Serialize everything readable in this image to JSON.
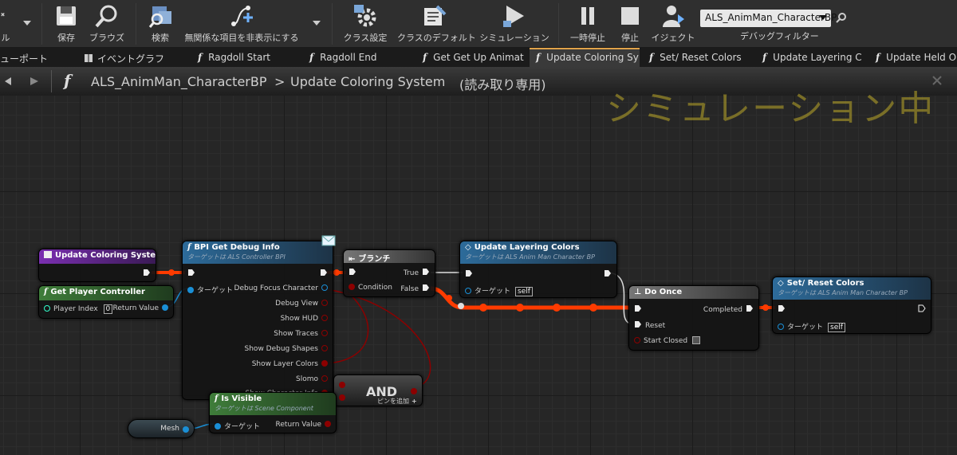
{
  "toolbar": {
    "partial_label": "ル",
    "buttons": [
      {
        "label": "保存"
      },
      {
        "label": "ブラウズ"
      },
      {
        "label": "検索"
      },
      {
        "label": "無関係な項目を非表示にする"
      },
      {
        "label": "クラス設定"
      },
      {
        "label": "クラスのデフォルト"
      },
      {
        "label": "シミュレーション"
      },
      {
        "label": "一時停止"
      },
      {
        "label": "停止"
      },
      {
        "label": "イジェクト"
      }
    ],
    "debug_object": "ALS_AnimMan_CharacterBP",
    "debug_filter_label": "デバッグフィルター"
  },
  "tabs": [
    {
      "label": "ューポート"
    },
    {
      "label": "イベントグラフ"
    },
    {
      "label": "Ragdoll Start"
    },
    {
      "label": "Ragdoll End"
    },
    {
      "label": "Get Get Up Animat"
    },
    {
      "label": "Update Coloring Sy"
    },
    {
      "label": "Set/ Reset Colors"
    },
    {
      "label": "Update Layering C"
    },
    {
      "label": "Update Held Obje"
    }
  ],
  "breadcrumb": {
    "blueprint": "ALS_AnimMan_CharacterBP",
    "separator": ">",
    "function": "Update Coloring System",
    "readonly": "(読み取り専用)"
  },
  "watermark": "シミュレーション中",
  "nodes": {
    "entry": {
      "title": "Update Coloring System"
    },
    "get_pc": {
      "title": "Get Player Controller",
      "player_index_label": "Player Index",
      "player_index_value": "0",
      "return_label": "Return Value"
    },
    "bpi": {
      "title": "BPI Get Debug Info",
      "subtitle": "ターゲットは ALS Controller BPI",
      "target_label": "ターゲット",
      "outputs": [
        "Debug Focus Character",
        "Debug View",
        "Show HUD",
        "Show Traces",
        "Show Debug Shapes",
        "Show Layer Colors",
        "Slomo",
        "Show Character Info"
      ]
    },
    "branch": {
      "title": "ブランチ",
      "condition": "Condition",
      "true_label": "True",
      "false_label": "False"
    },
    "update_layering": {
      "title": "Update Layering Colors",
      "subtitle": "ターゲットは ALS Anim Man Character BP",
      "target_label": "ターゲット",
      "self": "self"
    },
    "do_once": {
      "title": "Do Once",
      "completed": "Completed",
      "reset": "Reset",
      "start_closed": "Start Closed"
    },
    "set_reset": {
      "title": "Set/ Reset Colors",
      "subtitle": "ターゲットは ALS Anim Man Character BP",
      "target_label": "ターゲット",
      "self": "self"
    },
    "and_node": {
      "title": "AND",
      "add_pin": "ピンを追加"
    },
    "is_visible": {
      "title": "Is Visible",
      "subtitle": "ターゲットは Scene Component",
      "target_label": "ターゲット",
      "return_label": "Return Value"
    },
    "mesh": {
      "label": "Mesh"
    }
  },
  "colors": {
    "exec_active": "#ff3b00",
    "bool_pin": "#8c0000",
    "object_pin": "#1a8fd6",
    "accent_tab": "#e0a24a",
    "watermark": "#beaa28"
  }
}
